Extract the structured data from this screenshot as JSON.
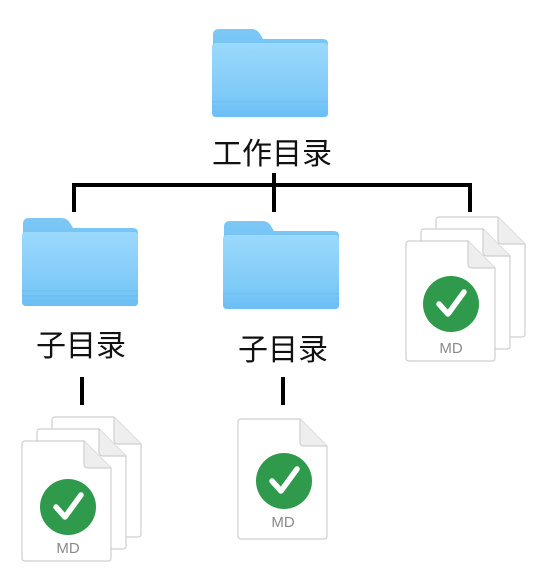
{
  "root": {
    "label": "工作目录",
    "icon": "folder-icon"
  },
  "children": [
    {
      "label": "子目录",
      "icon": "folder-icon",
      "contains": "stacked-markdown-files-icon"
    },
    {
      "label": "子目录",
      "icon": "folder-icon",
      "contains": "markdown-file-icon"
    },
    {
      "icon": "stacked-markdown-files-icon"
    }
  ],
  "file_type_label": "MD",
  "colors": {
    "folder_top": "#8fd3fb",
    "folder_bottom": "#5ab8f0",
    "badge": "#2f9a4b",
    "line": "#000000"
  }
}
